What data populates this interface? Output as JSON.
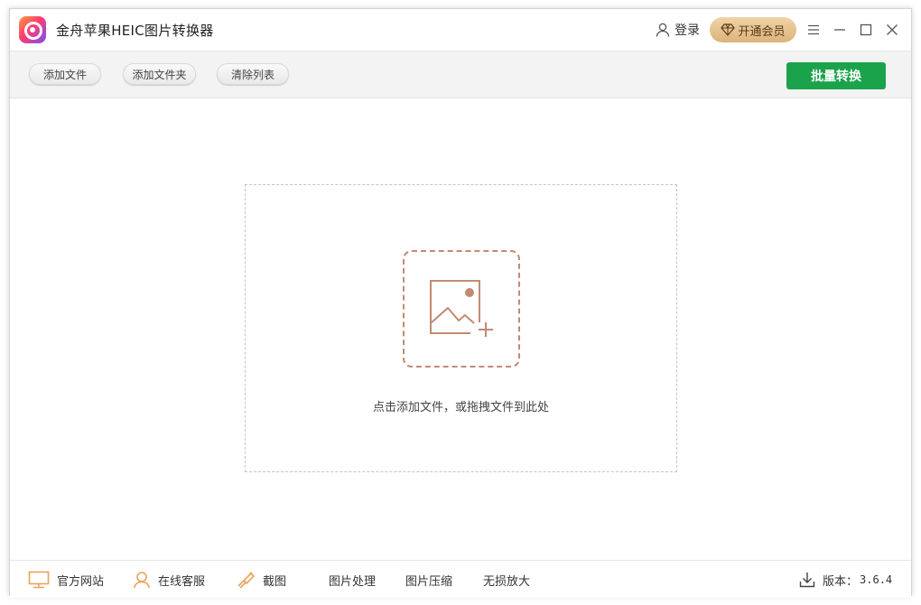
{
  "app": {
    "title": "金舟苹果HEIC图片转换器"
  },
  "header": {
    "login_label": "登录",
    "vip_label": "开通会员"
  },
  "toolbar": {
    "add_file": "添加文件",
    "add_folder": "添加文件夹",
    "clear_list": "清除列表",
    "batch_convert": "批量转换"
  },
  "dropzone": {
    "hint": "点击添加文件，或拖拽文件到此处"
  },
  "footer": {
    "official_site": "官方网站",
    "online_service": "在线客服",
    "screenshot": "截图",
    "image_process": "图片处理",
    "image_compress": "图片压缩",
    "lossless_enlarge": "无损放大",
    "version_label": "版本：",
    "version_number": "3.6.4"
  },
  "colors": {
    "accent_green": "#1aa34a",
    "vip_gold": "#dcb37b",
    "icon_orange": "#e8a25a",
    "add_box_brown": "#c38a72"
  },
  "icons": [
    "app-logo-icon",
    "user-icon",
    "diamond-icon",
    "menu-icon",
    "minimize-icon",
    "maximize-icon",
    "close-icon",
    "image-add-icon",
    "monitor-icon",
    "service-icon",
    "screenshot-icon",
    "download-icon"
  ]
}
